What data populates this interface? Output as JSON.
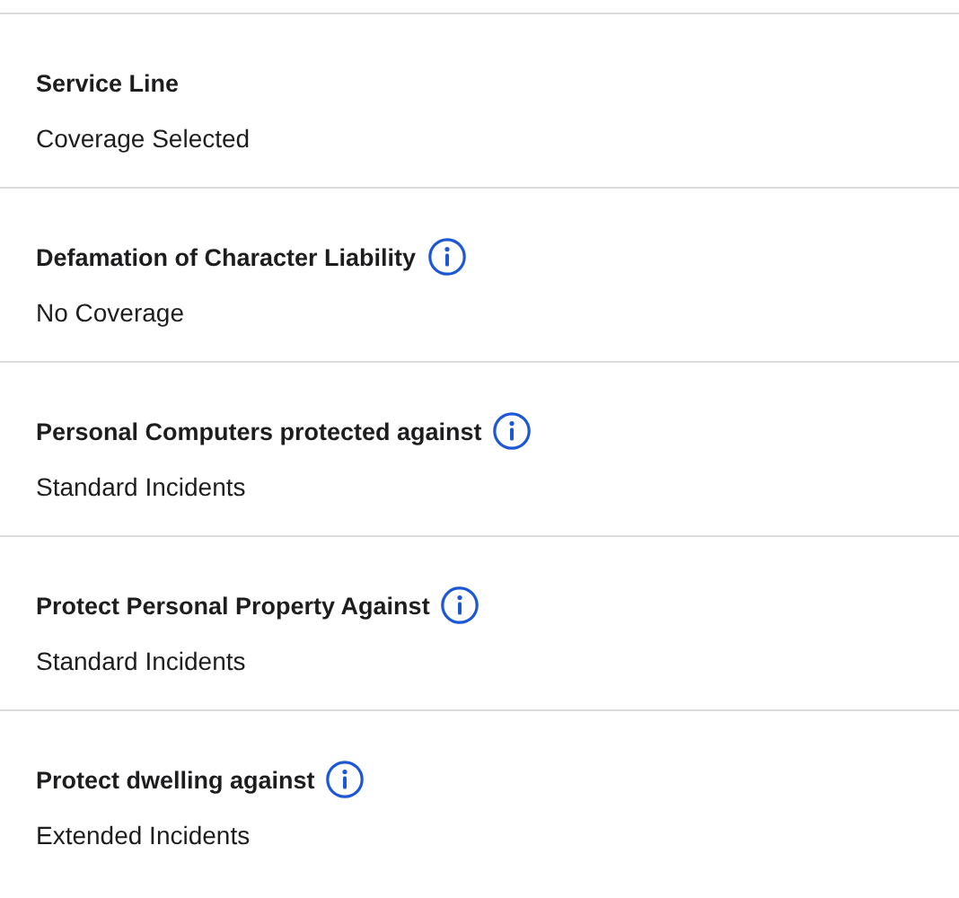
{
  "coverages": [
    {
      "title": "Service Line",
      "value": "Coverage Selected",
      "info": false
    },
    {
      "title": "Defamation of Character Liability",
      "value": "No Coverage",
      "info": true
    },
    {
      "title": "Personal Computers protected against",
      "value": "Standard Incidents",
      "info": true
    },
    {
      "title": "Protect Personal Property Against",
      "value": "Standard Incidents",
      "info": true
    },
    {
      "title": "Protect dwelling against",
      "value": "Extended Incidents",
      "info": true
    }
  ]
}
